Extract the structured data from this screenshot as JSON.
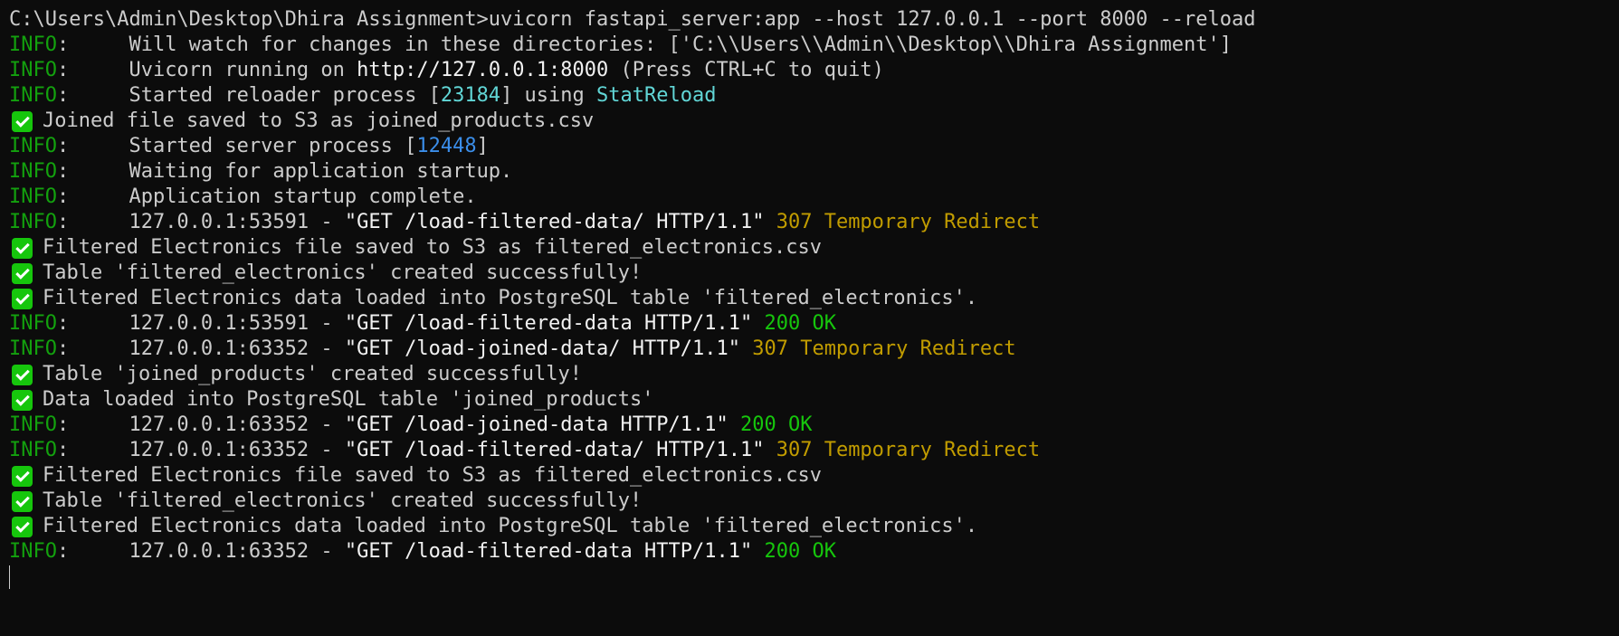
{
  "terminal": {
    "lines": [
      {
        "type": "plain",
        "segments": [
          {
            "text": "C:\\Users\\Admin\\Desktop\\Dhira Assignment>uvicorn fastapi_server:app --host 127.0.0.1 --port 8000 --reload",
            "color": "default"
          }
        ]
      },
      {
        "type": "plain",
        "segments": [
          {
            "text": "INFO",
            "color": "info"
          },
          {
            "text": ":     Will watch for changes in these directories: ['C:\\\\Users\\\\Admin\\\\Desktop\\\\Dhira Assignment']",
            "color": "default"
          }
        ]
      },
      {
        "type": "plain",
        "segments": [
          {
            "text": "INFO",
            "color": "info"
          },
          {
            "text": ":     Uvicorn running on ",
            "color": "default"
          },
          {
            "text": "http://127.0.0.1:8000",
            "color": "bright"
          },
          {
            "text": " (Press CTRL+C to quit)",
            "color": "default"
          }
        ]
      },
      {
        "type": "plain",
        "segments": [
          {
            "text": "INFO",
            "color": "info"
          },
          {
            "text": ":     Started reloader process [",
            "color": "default"
          },
          {
            "text": "23184",
            "color": "cyan"
          },
          {
            "text": "] using ",
            "color": "default"
          },
          {
            "text": "StatReload",
            "color": "cyan"
          }
        ]
      },
      {
        "type": "check",
        "segments": [
          {
            "text": "Joined file saved to S3 as joined_products.csv",
            "color": "default"
          }
        ]
      },
      {
        "type": "plain",
        "segments": [
          {
            "text": "INFO",
            "color": "info"
          },
          {
            "text": ":     Started server process [",
            "color": "default"
          },
          {
            "text": "12448",
            "color": "blue"
          },
          {
            "text": "]",
            "color": "default"
          }
        ]
      },
      {
        "type": "plain",
        "segments": [
          {
            "text": "INFO",
            "color": "info"
          },
          {
            "text": ":     Waiting for application startup.",
            "color": "default"
          }
        ]
      },
      {
        "type": "plain",
        "segments": [
          {
            "text": "INFO",
            "color": "info"
          },
          {
            "text": ":     Application startup complete.",
            "color": "default"
          }
        ]
      },
      {
        "type": "plain",
        "segments": [
          {
            "text": "INFO",
            "color": "info"
          },
          {
            "text": ":     127.0.0.1:53591 - ",
            "color": "default"
          },
          {
            "text": "\"GET /load-filtered-data/ HTTP/1.1\"",
            "color": "bright"
          },
          {
            "text": " ",
            "color": "default"
          },
          {
            "text": "307 Temporary Redirect",
            "color": "yellow"
          }
        ]
      },
      {
        "type": "check",
        "segments": [
          {
            "text": "Filtered Electronics file saved to S3 as filtered_electronics.csv",
            "color": "default"
          }
        ]
      },
      {
        "type": "check",
        "segments": [
          {
            "text": "Table 'filtered_electronics' created successfully!",
            "color": "default"
          }
        ]
      },
      {
        "type": "check",
        "segments": [
          {
            "text": "Filtered Electronics data loaded into PostgreSQL table 'filtered_electronics'.",
            "color": "default"
          }
        ]
      },
      {
        "type": "plain",
        "segments": [
          {
            "text": "INFO",
            "color": "info"
          },
          {
            "text": ":     127.0.0.1:53591 - ",
            "color": "default"
          },
          {
            "text": "\"GET /load-filtered-data HTTP/1.1\"",
            "color": "bright"
          },
          {
            "text": " ",
            "color": "default"
          },
          {
            "text": "200 OK",
            "color": "green"
          }
        ]
      },
      {
        "type": "plain",
        "segments": [
          {
            "text": "INFO",
            "color": "info"
          },
          {
            "text": ":     127.0.0.1:63352 - ",
            "color": "default"
          },
          {
            "text": "\"GET /load-joined-data/ HTTP/1.1\"",
            "color": "bright"
          },
          {
            "text": " ",
            "color": "default"
          },
          {
            "text": "307 Temporary Redirect",
            "color": "yellow"
          }
        ]
      },
      {
        "type": "check",
        "segments": [
          {
            "text": "Table 'joined_products' created successfully!",
            "color": "default"
          }
        ]
      },
      {
        "type": "check",
        "segments": [
          {
            "text": "Data loaded into PostgreSQL table 'joined_products'",
            "color": "default"
          }
        ]
      },
      {
        "type": "plain",
        "segments": [
          {
            "text": "INFO",
            "color": "info"
          },
          {
            "text": ":     127.0.0.1:63352 - ",
            "color": "default"
          },
          {
            "text": "\"GET /load-joined-data HTTP/1.1\"",
            "color": "bright"
          },
          {
            "text": " ",
            "color": "default"
          },
          {
            "text": "200 OK",
            "color": "green"
          }
        ]
      },
      {
        "type": "plain",
        "segments": [
          {
            "text": "INFO",
            "color": "info"
          },
          {
            "text": ":     127.0.0.1:63352 - ",
            "color": "default"
          },
          {
            "text": "\"GET /load-filtered-data/ HTTP/1.1\"",
            "color": "bright"
          },
          {
            "text": " ",
            "color": "default"
          },
          {
            "text": "307 Temporary Redirect",
            "color": "yellow"
          }
        ]
      },
      {
        "type": "check",
        "segments": [
          {
            "text": "Filtered Electronics file saved to S3 as filtered_electronics.csv",
            "color": "default"
          }
        ]
      },
      {
        "type": "check",
        "segments": [
          {
            "text": "Table 'filtered_electronics' created successfully!",
            "color": "default"
          }
        ]
      },
      {
        "type": "check",
        "segments": [
          {
            "text": "Filtered Electronics data loaded into PostgreSQL table 'filtered_electronics'.",
            "color": "default"
          }
        ]
      },
      {
        "type": "plain",
        "segments": [
          {
            "text": "INFO",
            "color": "info"
          },
          {
            "text": ":     127.0.0.1:63352 - ",
            "color": "default"
          },
          {
            "text": "\"GET /load-filtered-data HTTP/1.1\"",
            "color": "bright"
          },
          {
            "text": " ",
            "color": "default"
          },
          {
            "text": "200 OK",
            "color": "green"
          }
        ]
      }
    ]
  },
  "colors": {
    "background": "#0c0c0c",
    "default": "#cccccc",
    "info": "#13a10e",
    "bright": "#f2f2f2",
    "cyan": "#61d6d6",
    "blue": "#3b8eea",
    "yellow": "#c19c00",
    "green": "#16c60c",
    "check_icon": "#16c60c"
  }
}
